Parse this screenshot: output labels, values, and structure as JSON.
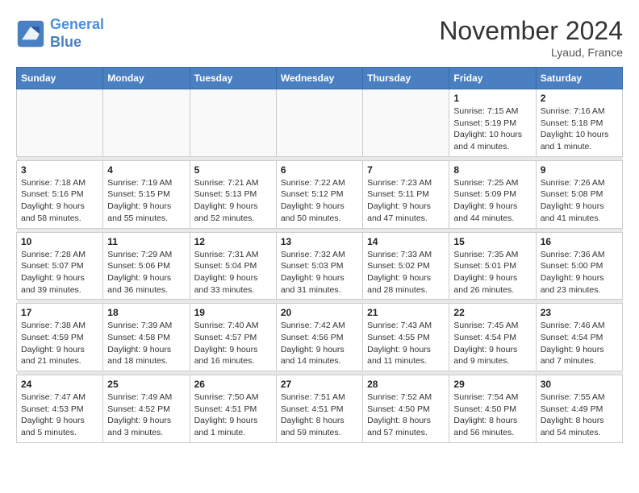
{
  "header": {
    "logo_line1": "General",
    "logo_line2": "Blue",
    "month": "November 2024",
    "location": "Lyaud, France"
  },
  "weekdays": [
    "Sunday",
    "Monday",
    "Tuesday",
    "Wednesday",
    "Thursday",
    "Friday",
    "Saturday"
  ],
  "weeks": [
    [
      {
        "day": "",
        "info": ""
      },
      {
        "day": "",
        "info": ""
      },
      {
        "day": "",
        "info": ""
      },
      {
        "day": "",
        "info": ""
      },
      {
        "day": "",
        "info": ""
      },
      {
        "day": "1",
        "info": "Sunrise: 7:15 AM\nSunset: 5:19 PM\nDaylight: 10 hours\nand 4 minutes."
      },
      {
        "day": "2",
        "info": "Sunrise: 7:16 AM\nSunset: 5:18 PM\nDaylight: 10 hours\nand 1 minute."
      }
    ],
    [
      {
        "day": "3",
        "info": "Sunrise: 7:18 AM\nSunset: 5:16 PM\nDaylight: 9 hours\nand 58 minutes."
      },
      {
        "day": "4",
        "info": "Sunrise: 7:19 AM\nSunset: 5:15 PM\nDaylight: 9 hours\nand 55 minutes."
      },
      {
        "day": "5",
        "info": "Sunrise: 7:21 AM\nSunset: 5:13 PM\nDaylight: 9 hours\nand 52 minutes."
      },
      {
        "day": "6",
        "info": "Sunrise: 7:22 AM\nSunset: 5:12 PM\nDaylight: 9 hours\nand 50 minutes."
      },
      {
        "day": "7",
        "info": "Sunrise: 7:23 AM\nSunset: 5:11 PM\nDaylight: 9 hours\nand 47 minutes."
      },
      {
        "day": "8",
        "info": "Sunrise: 7:25 AM\nSunset: 5:09 PM\nDaylight: 9 hours\nand 44 minutes."
      },
      {
        "day": "9",
        "info": "Sunrise: 7:26 AM\nSunset: 5:08 PM\nDaylight: 9 hours\nand 41 minutes."
      }
    ],
    [
      {
        "day": "10",
        "info": "Sunrise: 7:28 AM\nSunset: 5:07 PM\nDaylight: 9 hours\nand 39 minutes."
      },
      {
        "day": "11",
        "info": "Sunrise: 7:29 AM\nSunset: 5:06 PM\nDaylight: 9 hours\nand 36 minutes."
      },
      {
        "day": "12",
        "info": "Sunrise: 7:31 AM\nSunset: 5:04 PM\nDaylight: 9 hours\nand 33 minutes."
      },
      {
        "day": "13",
        "info": "Sunrise: 7:32 AM\nSunset: 5:03 PM\nDaylight: 9 hours\nand 31 minutes."
      },
      {
        "day": "14",
        "info": "Sunrise: 7:33 AM\nSunset: 5:02 PM\nDaylight: 9 hours\nand 28 minutes."
      },
      {
        "day": "15",
        "info": "Sunrise: 7:35 AM\nSunset: 5:01 PM\nDaylight: 9 hours\nand 26 minutes."
      },
      {
        "day": "16",
        "info": "Sunrise: 7:36 AM\nSunset: 5:00 PM\nDaylight: 9 hours\nand 23 minutes."
      }
    ],
    [
      {
        "day": "17",
        "info": "Sunrise: 7:38 AM\nSunset: 4:59 PM\nDaylight: 9 hours\nand 21 minutes."
      },
      {
        "day": "18",
        "info": "Sunrise: 7:39 AM\nSunset: 4:58 PM\nDaylight: 9 hours\nand 18 minutes."
      },
      {
        "day": "19",
        "info": "Sunrise: 7:40 AM\nSunset: 4:57 PM\nDaylight: 9 hours\nand 16 minutes."
      },
      {
        "day": "20",
        "info": "Sunrise: 7:42 AM\nSunset: 4:56 PM\nDaylight: 9 hours\nand 14 minutes."
      },
      {
        "day": "21",
        "info": "Sunrise: 7:43 AM\nSunset: 4:55 PM\nDaylight: 9 hours\nand 11 minutes."
      },
      {
        "day": "22",
        "info": "Sunrise: 7:45 AM\nSunset: 4:54 PM\nDaylight: 9 hours\nand 9 minutes."
      },
      {
        "day": "23",
        "info": "Sunrise: 7:46 AM\nSunset: 4:54 PM\nDaylight: 9 hours\nand 7 minutes."
      }
    ],
    [
      {
        "day": "24",
        "info": "Sunrise: 7:47 AM\nSunset: 4:53 PM\nDaylight: 9 hours\nand 5 minutes."
      },
      {
        "day": "25",
        "info": "Sunrise: 7:49 AM\nSunset: 4:52 PM\nDaylight: 9 hours\nand 3 minutes."
      },
      {
        "day": "26",
        "info": "Sunrise: 7:50 AM\nSunset: 4:51 PM\nDaylight: 9 hours\nand 1 minute."
      },
      {
        "day": "27",
        "info": "Sunrise: 7:51 AM\nSunset: 4:51 PM\nDaylight: 8 hours\nand 59 minutes."
      },
      {
        "day": "28",
        "info": "Sunrise: 7:52 AM\nSunset: 4:50 PM\nDaylight: 8 hours\nand 57 minutes."
      },
      {
        "day": "29",
        "info": "Sunrise: 7:54 AM\nSunset: 4:50 PM\nDaylight: 8 hours\nand 56 minutes."
      },
      {
        "day": "30",
        "info": "Sunrise: 7:55 AM\nSunset: 4:49 PM\nDaylight: 8 hours\nand 54 minutes."
      }
    ]
  ]
}
